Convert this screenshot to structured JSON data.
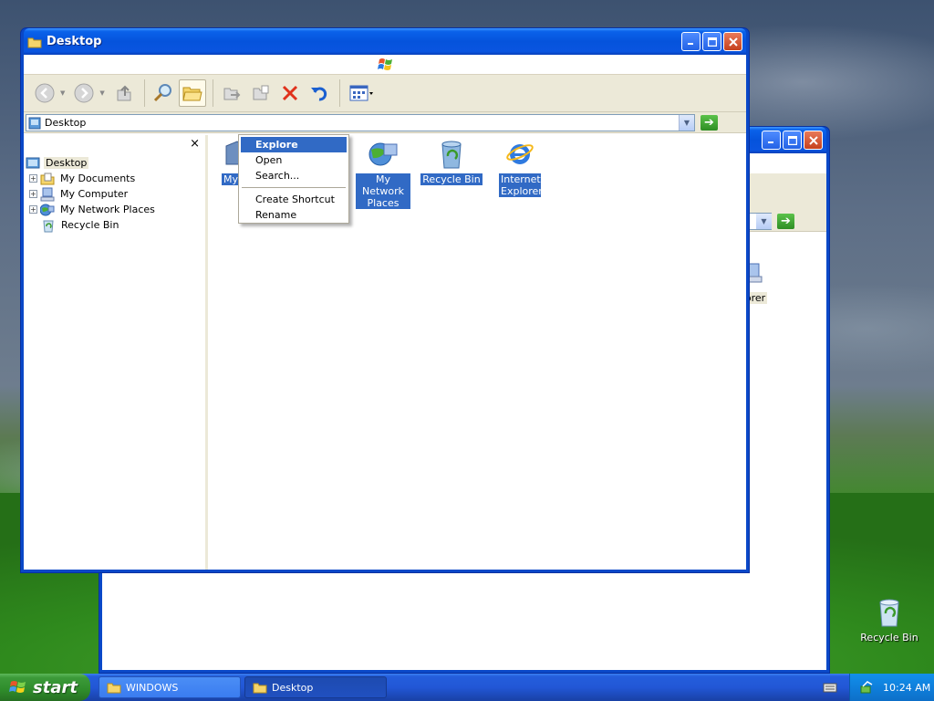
{
  "main_window": {
    "title": "Desktop",
    "address": "Desktop",
    "folders_close": "×",
    "tree": [
      {
        "label": "Desktop",
        "root": true
      },
      {
        "label": "My Documents"
      },
      {
        "label": "My Computer"
      },
      {
        "label": "My Network Places"
      },
      {
        "label": "Recycle Bin"
      }
    ],
    "files": [
      {
        "label": "My D"
      },
      {
        "label": "My Network Places"
      },
      {
        "label": "Recycle Bin"
      },
      {
        "label": "Internet Explorer"
      }
    ]
  },
  "context_menu": {
    "items": [
      "Explore",
      "Open",
      "Search...",
      "Create Shortcut",
      "Rename"
    ]
  },
  "back_window": {
    "file_label": "plorer"
  },
  "desktop_icon": {
    "label": "Recycle Bin"
  },
  "taskbar": {
    "start_label": "start",
    "tasks": [
      "WINDOWS",
      "Desktop"
    ],
    "clock": "10:24 AM"
  },
  "colors": {
    "selection": "#316ac5",
    "titlebar": "#0553dc",
    "start": "#2f8c2b"
  }
}
